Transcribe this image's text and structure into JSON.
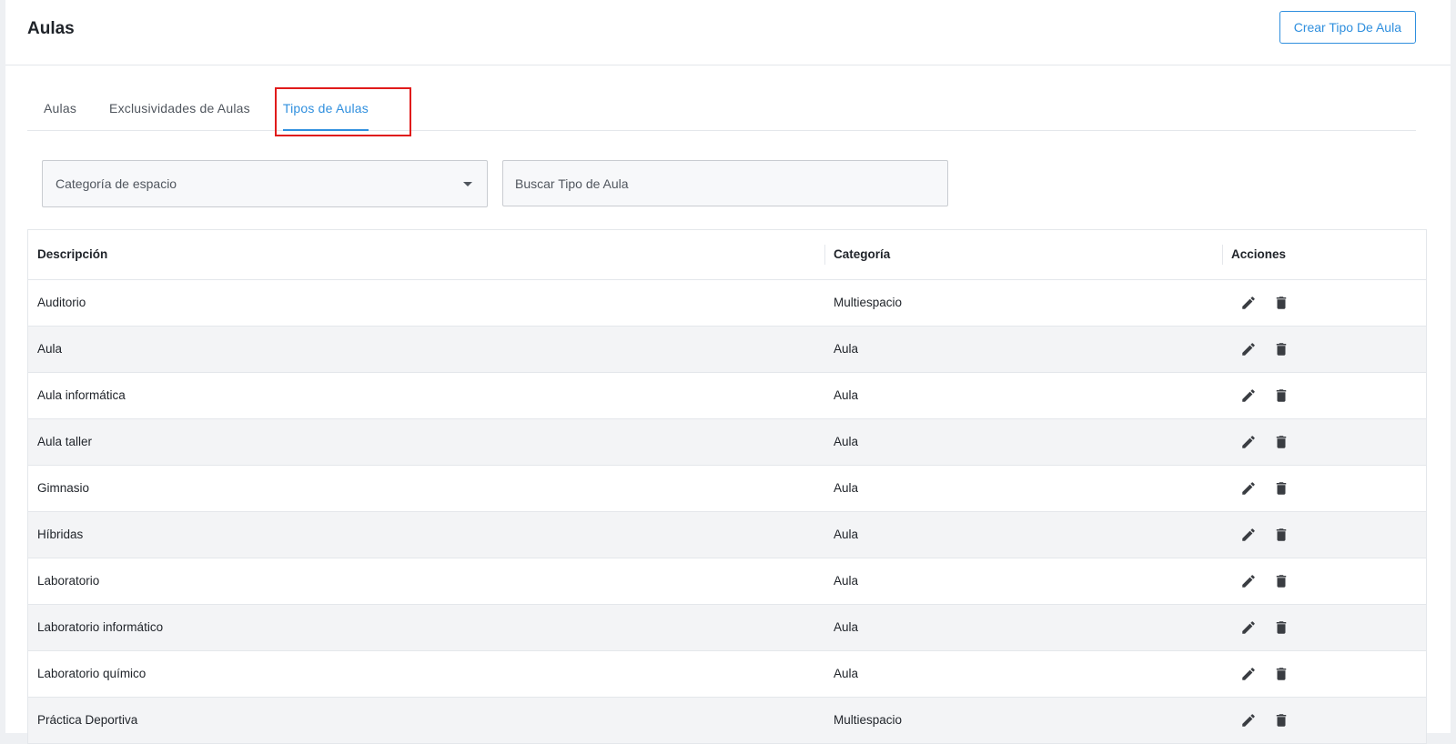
{
  "header": {
    "title": "Aulas",
    "create_button": "Crear Tipo De Aula"
  },
  "tabs": [
    {
      "label": "Aulas",
      "active": false
    },
    {
      "label": "Exclusividades de Aulas",
      "active": false
    },
    {
      "label": "Tipos de Aulas",
      "active": true
    }
  ],
  "filters": {
    "category_select": {
      "placeholder": "Categoría de espacio",
      "value": ""
    },
    "search": {
      "placeholder": "Buscar Tipo de Aula",
      "value": ""
    }
  },
  "table": {
    "columns": [
      "Descripción",
      "Categoría",
      "Acciones"
    ],
    "rows": [
      {
        "descripcion": "Auditorio",
        "categoria": "Multiespacio"
      },
      {
        "descripcion": "Aula",
        "categoria": "Aula"
      },
      {
        "descripcion": "Aula informática",
        "categoria": "Aula"
      },
      {
        "descripcion": "Aula taller",
        "categoria": "Aula"
      },
      {
        "descripcion": "Gimnasio",
        "categoria": "Aula"
      },
      {
        "descripcion": "Híbridas",
        "categoria": "Aula"
      },
      {
        "descripcion": "Laboratorio",
        "categoria": "Aula"
      },
      {
        "descripcion": "Laboratorio informático",
        "categoria": "Aula"
      },
      {
        "descripcion": "Laboratorio químico",
        "categoria": "Aula"
      },
      {
        "descripcion": "Práctica Deportiva",
        "categoria": "Multiespacio"
      }
    ],
    "row_actions": [
      "pencil-icon",
      "trash-icon"
    ]
  },
  "colors": {
    "accent": "#2f8fde",
    "highlight": "#e01b1b",
    "alt_row": "#f3f4f6"
  }
}
